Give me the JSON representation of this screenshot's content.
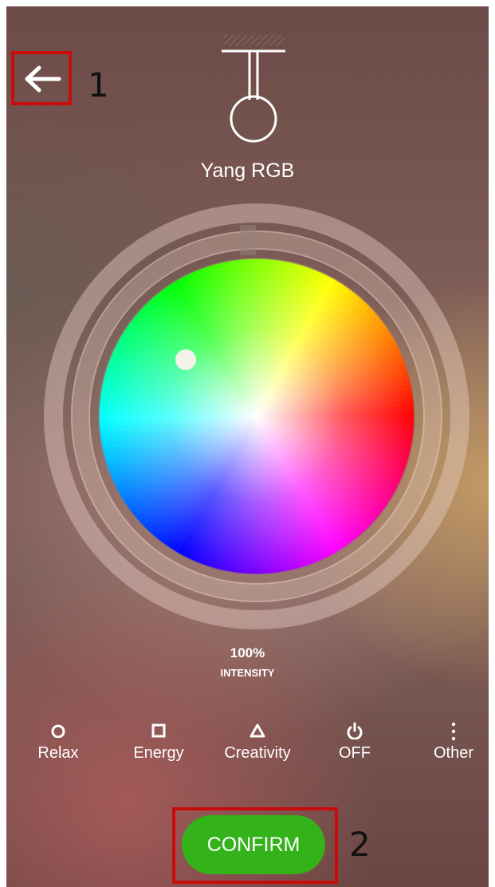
{
  "device": {
    "name": "Yang RGB",
    "icon": "pendant-lamp-icon"
  },
  "header": {
    "back_icon": "arrow-left-icon"
  },
  "annotations": {
    "marker_1": "1",
    "marker_2": "2",
    "marker_color": "#c80c0c"
  },
  "intensity": {
    "value": "100%",
    "label": "INTENSITY",
    "level_fraction": 1.0
  },
  "modes": [
    {
      "label": "Relax",
      "icon": "circle-icon"
    },
    {
      "label": "Energy",
      "icon": "square-icon"
    },
    {
      "label": "Creativity",
      "icon": "triangle-icon"
    },
    {
      "label": "OFF",
      "icon": "power-icon"
    },
    {
      "label": "Other",
      "icon": "more-vertical-icon"
    }
  ],
  "confirm": {
    "label": "CONFIRM",
    "color": "#33b21a"
  },
  "colors": {
    "text": "#ffffff"
  }
}
